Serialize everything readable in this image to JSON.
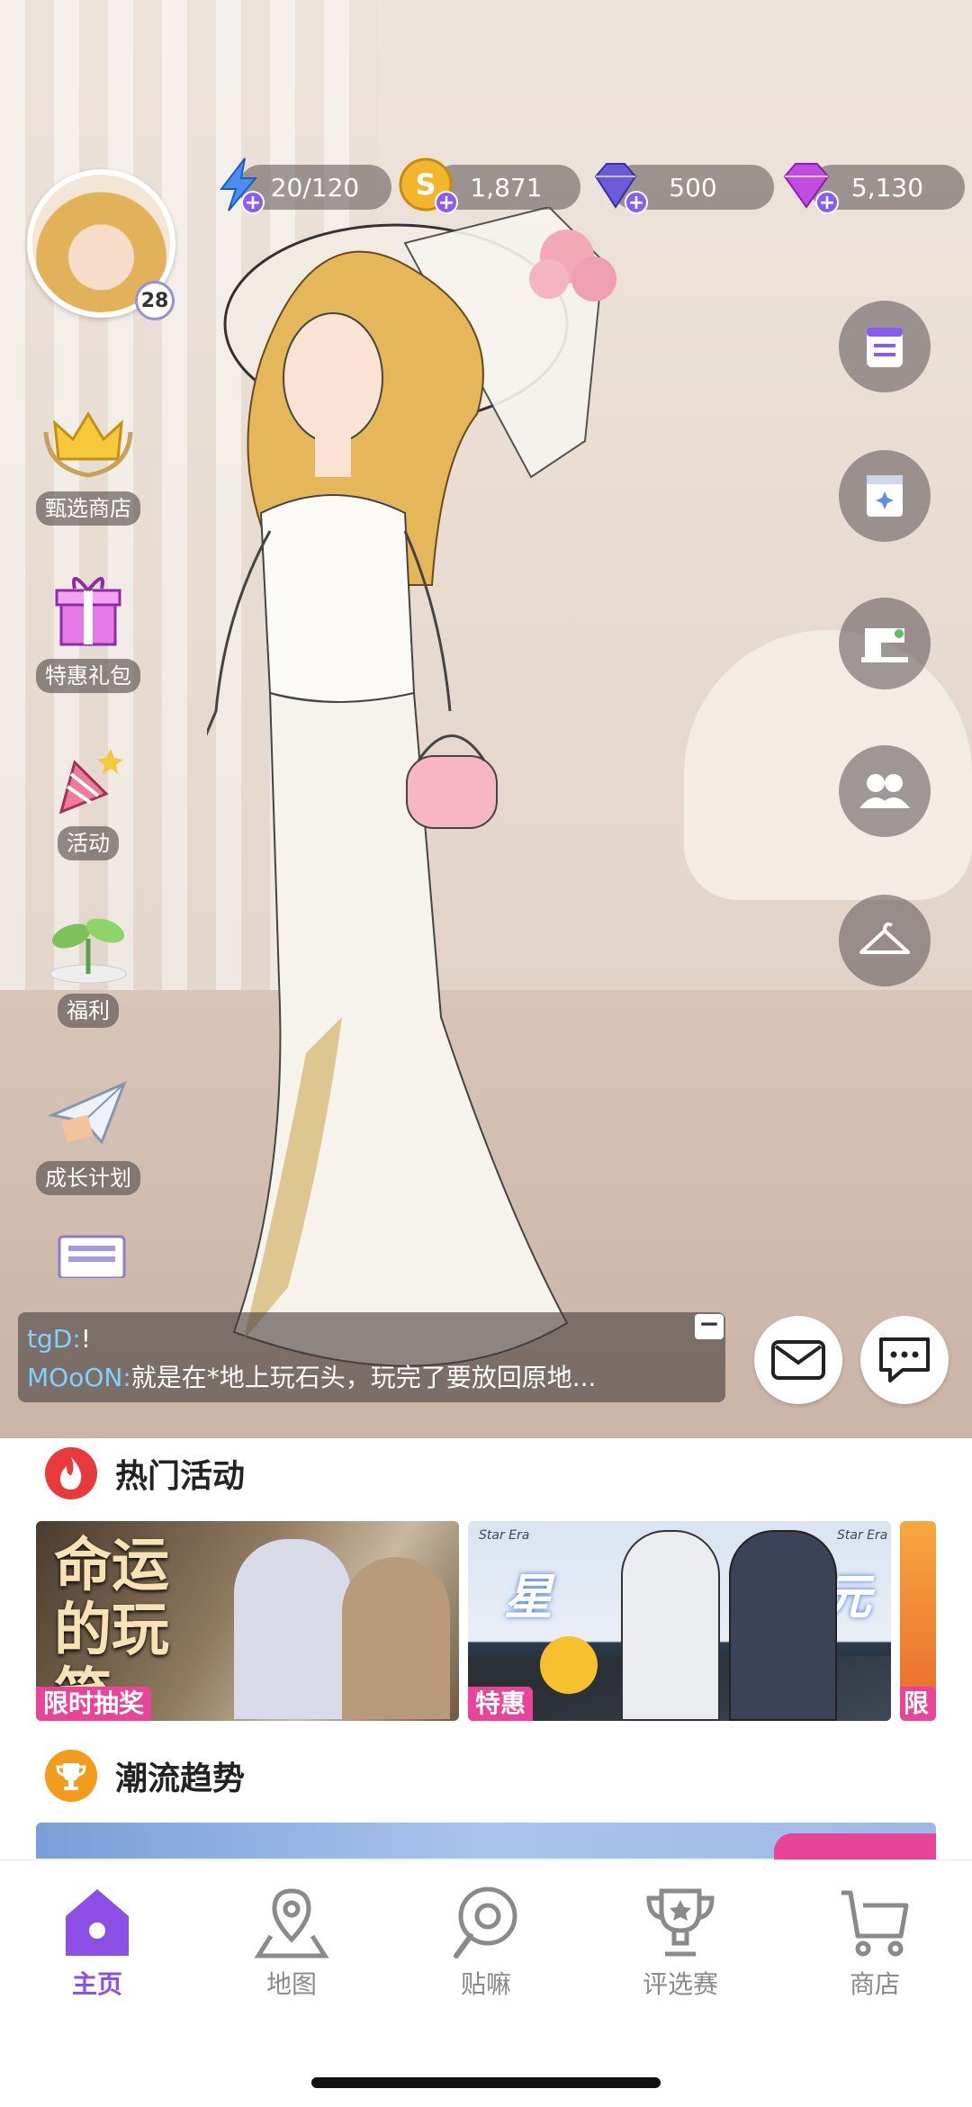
{
  "resources": [
    {
      "name": "energy",
      "icon": "lightning-icon",
      "value": "20/120"
    },
    {
      "name": "coins",
      "icon": "coin-icon",
      "value": "1,871"
    },
    {
      "name": "diamonds",
      "icon": "diamond-icon",
      "value": "500"
    },
    {
      "name": "gems",
      "icon": "gem-icon",
      "value": "5,130"
    }
  ],
  "player": {
    "level": "28"
  },
  "left_menu": [
    {
      "label": "甄选商店",
      "icon": "crown-icon"
    },
    {
      "label": "特惠礼包",
      "icon": "gift-icon"
    },
    {
      "label": "活动",
      "icon": "party-horn-icon"
    },
    {
      "label": "福利",
      "icon": "sprout-icon"
    },
    {
      "label": "成长计划",
      "icon": "paper-plane-icon"
    }
  ],
  "right_menu": [
    {
      "icon": "notepad-icon"
    },
    {
      "icon": "book-icon"
    },
    {
      "icon": "sewing-machine-icon"
    },
    {
      "icon": "friends-icon"
    },
    {
      "icon": "hanger-icon"
    }
  ],
  "chat": {
    "messages": [
      {
        "user": "tgD:",
        "text": "!"
      },
      {
        "user": "MOoON:",
        "text": "就是在*地上玩石头，玩完了要放回原地..."
      }
    ],
    "minimize": "−"
  },
  "hot_events": {
    "title": "热门活动",
    "banners": [
      {
        "title": "命运的玩笑",
        "tag": "限时抽奖"
      },
      {
        "title": "星纪元",
        "left": "星",
        "right": "纪元",
        "brand": "Star Era",
        "tag": "特惠"
      },
      {
        "tag": "限"
      }
    ]
  },
  "trends": {
    "title": "潮流趋势"
  },
  "nav": [
    {
      "label": "主页",
      "icon": "home-icon",
      "active": true
    },
    {
      "label": "地图",
      "icon": "map-pin-icon"
    },
    {
      "label": "贴嘛",
      "icon": "chat-bubble-icon"
    },
    {
      "label": "评选赛",
      "icon": "trophy-icon"
    },
    {
      "label": "商店",
      "icon": "cart-icon"
    }
  ],
  "colors": {
    "accent": "#8b4fe6",
    "hot": "#e83a3a",
    "trend": "#f29b1d"
  }
}
